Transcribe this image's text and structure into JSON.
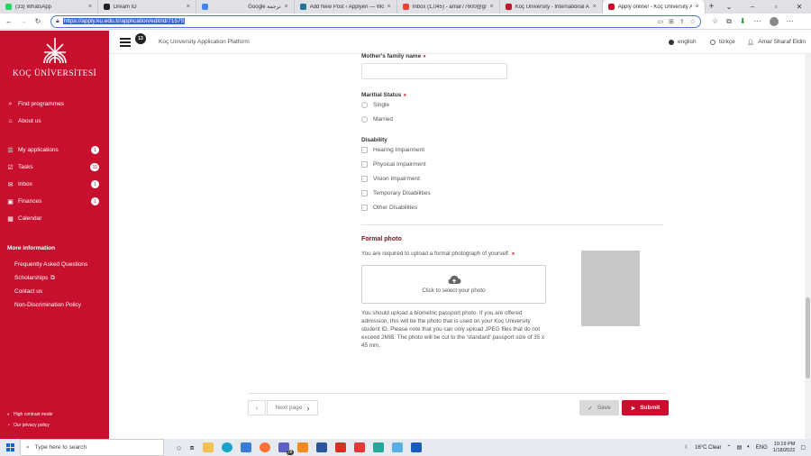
{
  "browser": {
    "tabs": [
      {
        "title": "(33) WhatsApp",
        "color": "#25d366",
        "active": false
      },
      {
        "title": "Dream ID",
        "color": "#222222",
        "active": false
      },
      {
        "title": "Google ترجمة",
        "color": "#4285f4",
        "active": false
      },
      {
        "title": "Add New Post ‹ Applyen — Wo",
        "color": "#21759b",
        "active": false
      },
      {
        "title": "Inbox (1,045) - amar77600@gm",
        "color": "#ea4335",
        "active": false
      },
      {
        "title": "Koç University - International A",
        "color": "#c8102e",
        "active": false
      },
      {
        "title": "Apply online! - Koç University A",
        "color": "#c8102e",
        "active": true
      }
    ],
    "url": "https://apply.ku.edu.tr/application/edit/id/71575"
  },
  "sidebar": {
    "logo_text": "KOÇ ÜNİVERSİTESİ",
    "top_items": [
      {
        "label": "Find programmes",
        "icon": "search-icon",
        "glyph": "⌕"
      },
      {
        "label": "About us",
        "icon": "university-icon",
        "glyph": "⌂"
      }
    ],
    "items": [
      {
        "label": "My applications",
        "icon": "applications-icon",
        "glyph": "☰",
        "badge": "1"
      },
      {
        "label": "Tasks",
        "icon": "tasks-icon",
        "glyph": "☑",
        "badge": "10"
      },
      {
        "label": "Inbox",
        "icon": "inbox-icon",
        "glyph": "✉",
        "badge": "1"
      },
      {
        "label": "Finances",
        "icon": "finances-icon",
        "glyph": "▣",
        "badge": "1"
      },
      {
        "label": "Calendar",
        "icon": "calendar-icon",
        "glyph": "▦",
        "badge": ""
      }
    ],
    "more_title": "More information",
    "more_links": [
      "Frequently Asked Questions",
      "Scholarships",
      "Contact us",
      "Non-Discrimination Policy"
    ],
    "bottom": [
      "High contrast mode",
      "Our privacy policy"
    ]
  },
  "header": {
    "notification_count": "13",
    "platform": "Koç University Application Platform",
    "lang_en": "english",
    "lang_tr": "türkçe",
    "user": "Amar Sharaf Eldin"
  },
  "form": {
    "mother_family_label": "Mother's family name",
    "marital_label": "Maritial Status",
    "marital_options": [
      "Single",
      "Married"
    ],
    "disability_label": "Disability",
    "disability_options": [
      "Hearing Impairment",
      "Physical Impairment",
      "Vision Impairment",
      "Temporary Disabilities",
      "Other Disabilities"
    ],
    "photo_title": "Formal photo",
    "photo_desc": "You are required to upload a formal photograph of yourself.",
    "upload_label": "Click to select your photo",
    "photo_help": "You should upload a biometric passport photo. If you are offered admission, this will be the photo that is used on your Koç University student ID. Please note that you can only upload JPEG files that do not exceed 2MiB. The photo will be cut to the 'standard' passport size of 35 x 45 mm."
  },
  "footer": {
    "next_label": "Next page",
    "save_label": "Save",
    "submit_label": "Submit"
  },
  "taskbar": {
    "search_placeholder": "Type here to search",
    "weather": "16°C  Clear",
    "lang": "ENG",
    "time": "10:19 PM",
    "date": "1/18/2022",
    "badge": "28"
  },
  "colors": {
    "brand": "#c8102e",
    "required": "#e0405a",
    "section_title": "#7a1422"
  }
}
